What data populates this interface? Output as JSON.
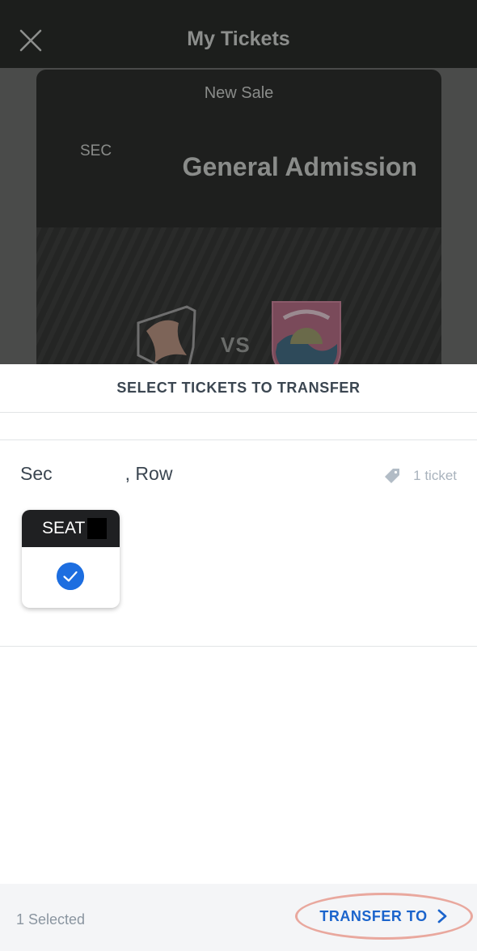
{
  "header": {
    "title": "My Tickets",
    "close_icon": "close-icon"
  },
  "ticket_card": {
    "label": "New Sale",
    "section_label": "SEC",
    "section_value": "General Admission",
    "vs": "VS"
  },
  "sheet": {
    "title": "SELECT TICKETS TO TRANSFER",
    "row_sec": "Sec",
    "row_row": ", Row",
    "ticket_count": "1 ticket",
    "tag_icon": "ticket-tag-icon",
    "seat_label": "SEAT",
    "seat_selected": true
  },
  "footer": {
    "selected_text": "1 Selected",
    "transfer_label": "TRANSFER TO",
    "accent_color": "#1b64cc",
    "highlight_color": "#e9a89e"
  }
}
